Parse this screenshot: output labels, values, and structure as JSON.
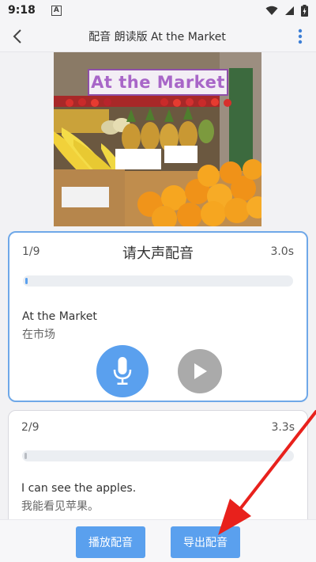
{
  "status_bar": {
    "time": "9:18",
    "notification_letter": "A"
  },
  "header": {
    "title": "配音 朗读版 At the Market"
  },
  "picture": {
    "sign_text": "At the Market"
  },
  "cards": [
    {
      "index": "1/9",
      "prompt": "请大声配音",
      "duration": "3.0s",
      "progress": 0.01,
      "sentence_en": "At the Market",
      "sentence_cn": "在市场",
      "active": true
    },
    {
      "index": "2/9",
      "duration": "3.3s",
      "progress": 0.01,
      "sentence_en": "I can see the apples.",
      "sentence_cn": "我能看见苹果。",
      "active": false
    }
  ],
  "bottom": {
    "play_dub_label": "播放配音",
    "export_dub_label": "导出配音"
  },
  "colors": {
    "accent": "#5aa0ee",
    "active_border": "#6fa8e8",
    "annotation_arrow": "#e8211c"
  },
  "icons": {
    "back": "back-arrow-icon",
    "more": "more-vertical-icon",
    "mic": "microphone-icon",
    "play": "play-icon",
    "wifi": "wifi-icon",
    "signal": "cell-signal-icon",
    "battery": "battery-charging-icon"
  }
}
